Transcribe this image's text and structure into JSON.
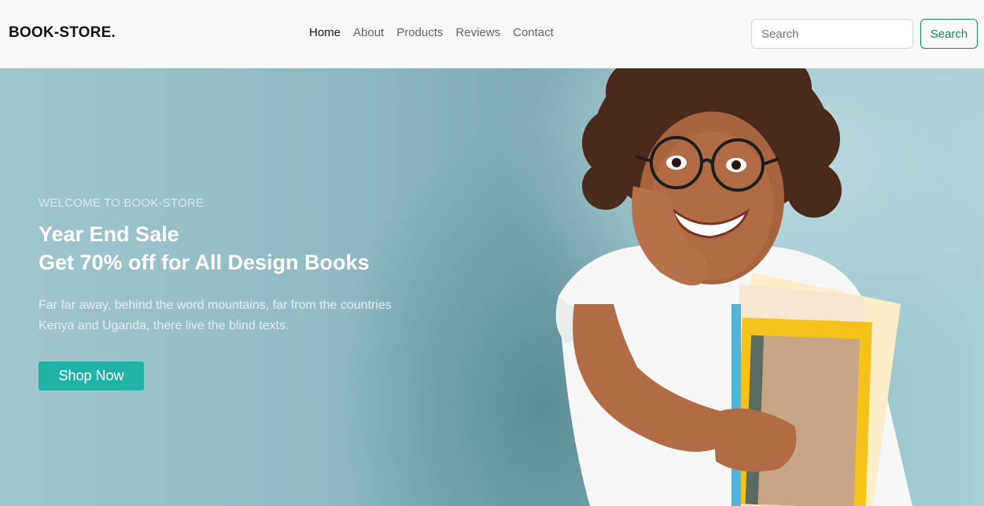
{
  "navbar": {
    "brand": "BOOK-STORE.",
    "links": [
      {
        "label": "Home",
        "active": true
      },
      {
        "label": "About",
        "active": false
      },
      {
        "label": "Products",
        "active": false
      },
      {
        "label": "Reviews",
        "active": false
      },
      {
        "label": "Contact",
        "active": false
      }
    ],
    "search": {
      "placeholder": "Search",
      "value": "",
      "button_label": "Search"
    }
  },
  "hero": {
    "subtitle": "WELCOME TO BOOK-STORE",
    "title_line1": "Year End Sale",
    "title_line2": "Get 70% off for All Design Books",
    "description_line1": "Far far away, behind the word mountains, far from the countries",
    "description_line2": "Kenya and Uganda, there live the blind texts.",
    "cta_label": "Shop Now"
  },
  "colors": {
    "accent": "#20b2a6",
    "search_button": "#198754",
    "hero_background": "#9fc6cc",
    "navbar_background": "#f8f9fa"
  }
}
